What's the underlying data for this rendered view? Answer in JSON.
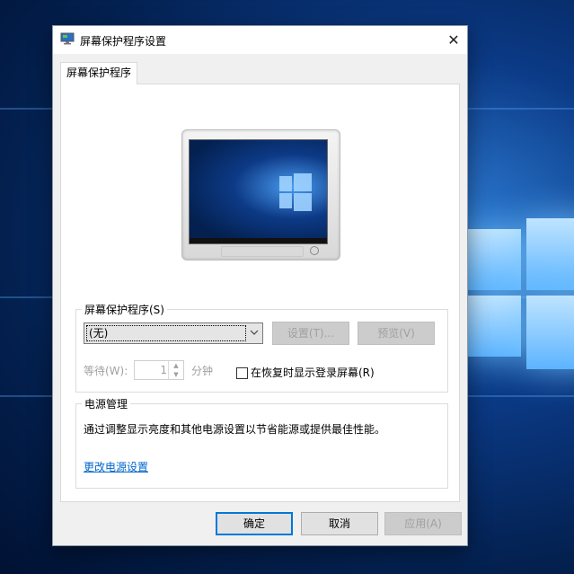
{
  "window": {
    "title": "屏幕保护程序设置",
    "close_glyph": "✕"
  },
  "tabs": [
    {
      "label": "屏幕保护程序",
      "active": true
    }
  ],
  "screensaver_group": {
    "label": "屏幕保护程序(S)",
    "selected_value": "(无)",
    "settings_button": "设置(T)...",
    "preview_button": "预览(V)",
    "wait_label": "等待(W):",
    "wait_value": "1",
    "wait_unit": "分钟",
    "resume_label": "在恢复时显示登录屏幕(R)",
    "resume_checked": false
  },
  "power_group": {
    "label": "电源管理",
    "description": "通过调整显示亮度和其他电源设置以节省能源或提供最佳性能。",
    "link_text": "更改电源设置"
  },
  "footer": {
    "ok": "确定",
    "cancel": "取消",
    "apply": "应用(A)"
  },
  "colors": {
    "accent": "#0078d7",
    "link": "#0066cc",
    "disabled_text": "#a0a0a0"
  }
}
